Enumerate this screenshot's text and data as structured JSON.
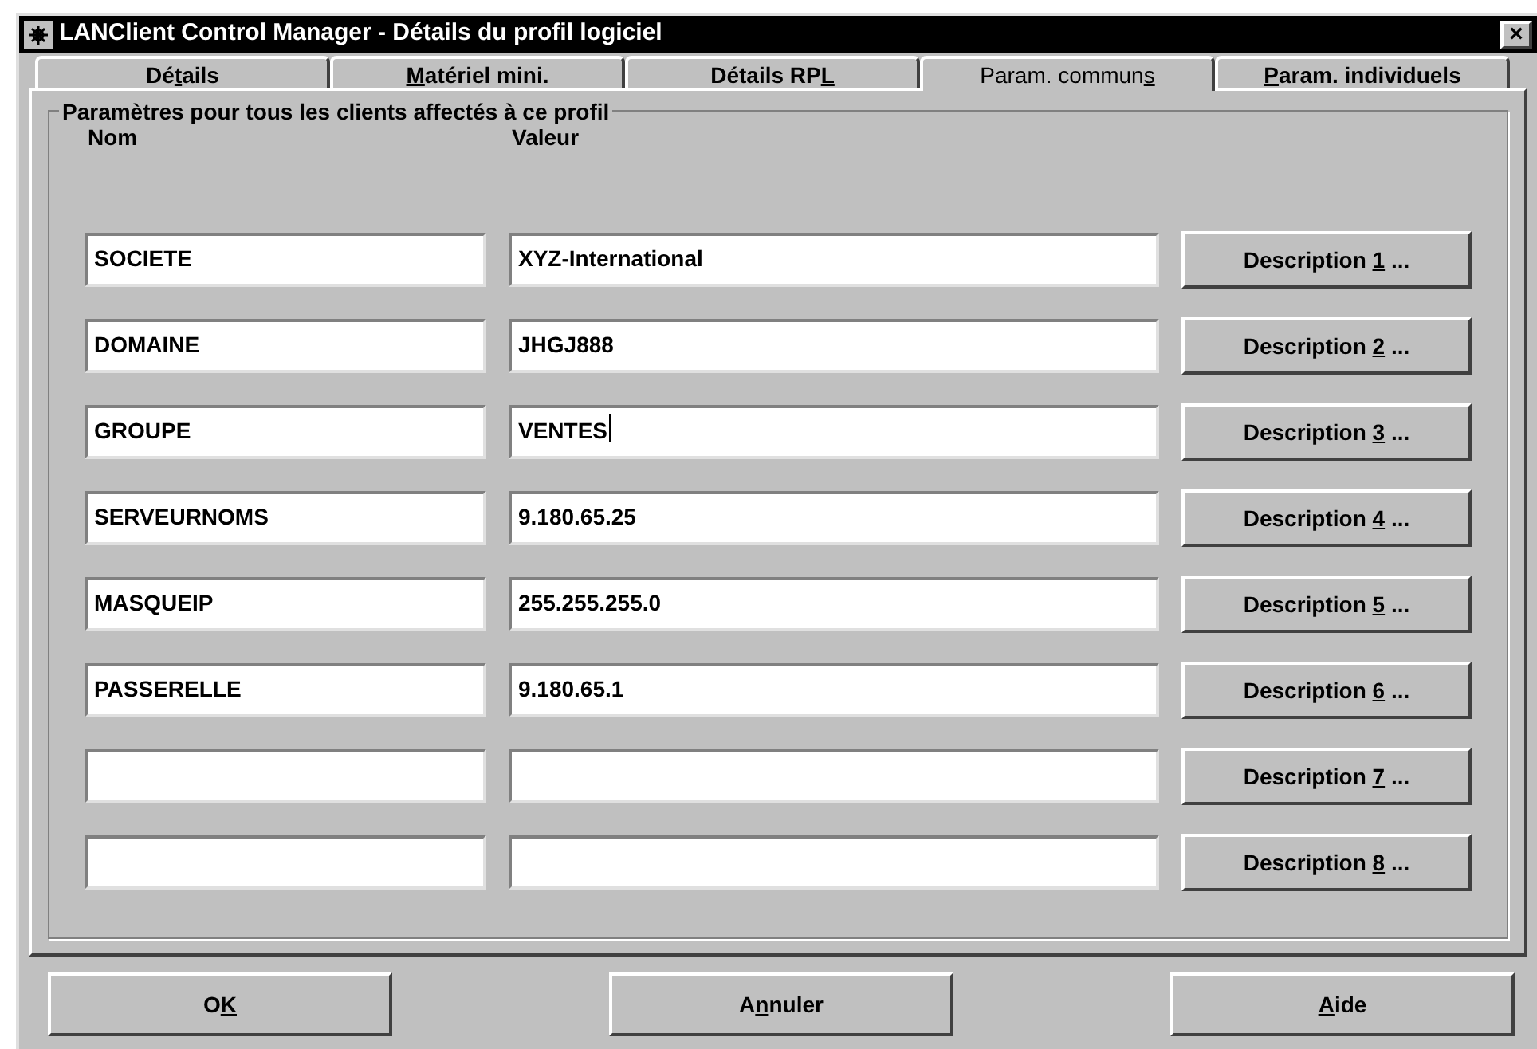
{
  "window": {
    "title": "LANClient Control Manager - Détails du profil logiciel",
    "close": "×"
  },
  "tabs": [
    {
      "pre": "Dé",
      "key": "t",
      "post": "ails",
      "selected": false
    },
    {
      "key": "M",
      "post": "atériel mini.",
      "selected": false
    },
    {
      "pre": "Détails RP",
      "key": "L",
      "selected": false
    },
    {
      "pre": "Param. commun",
      "key": "s",
      "selected": true
    },
    {
      "key": "P",
      "post": "aram. individuels",
      "selected": false
    }
  ],
  "group": {
    "title": "Paramètres pour tous les clients affectés à ce profil",
    "columns": [
      "Nom",
      "Valeur"
    ]
  },
  "rows": [
    {
      "name": "SOCIETE",
      "value": "XYZ-International",
      "caret": false,
      "button": {
        "pre": "Description ",
        "key": "1",
        "post": " ..."
      }
    },
    {
      "name": "DOMAINE",
      "value": "JHGJ888",
      "caret": false,
      "button": {
        "pre": "Description ",
        "key": "2",
        "post": " ..."
      }
    },
    {
      "name": "GROUPE",
      "value": "VENTES",
      "caret": true,
      "button": {
        "pre": "Description ",
        "key": "3",
        "post": " ..."
      }
    },
    {
      "name": "SERVEURNOMS",
      "value": "9.180.65.25",
      "caret": false,
      "button": {
        "pre": "Description ",
        "key": "4",
        "post": " ..."
      }
    },
    {
      "name": "MASQUEIP",
      "value": "255.255.255.0",
      "caret": false,
      "button": {
        "pre": "Description ",
        "key": "5",
        "post": " ..."
      }
    },
    {
      "name": "PASSERELLE",
      "value": "9.180.65.1",
      "caret": false,
      "button": {
        "pre": "Description ",
        "key": "6",
        "post": " ..."
      }
    },
    {
      "caret": false,
      "button": {
        "pre": "Description ",
        "key": "7",
        "post": " ..."
      }
    },
    {
      "caret": false,
      "button": {
        "pre": "Description ",
        "key": "8",
        "post": " ..."
      }
    }
  ],
  "buttons": [
    {
      "pre": "O",
      "key": "K"
    },
    {
      "pre": "A",
      "key": "n",
      "post": "nuler"
    },
    {
      "key": "A",
      "post": "ide"
    }
  ]
}
